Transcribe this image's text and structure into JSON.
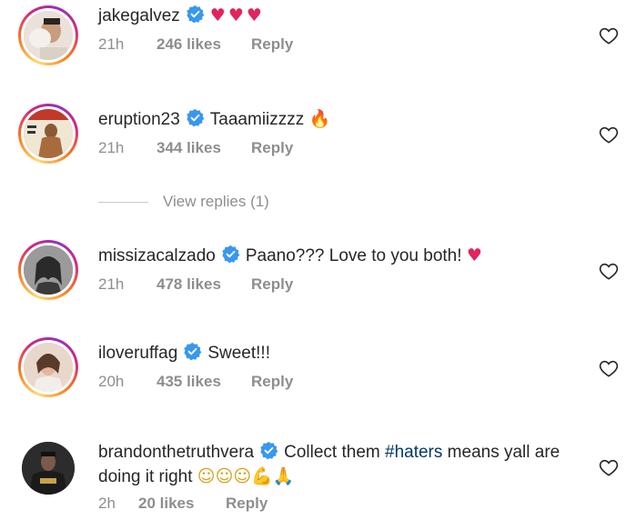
{
  "comments": [
    {
      "username": "jakegalvez",
      "verified": true,
      "text": "",
      "emoji": "♥♥♥",
      "time": "21h",
      "likes": "246 likes",
      "reply": "Reply",
      "avatar_color": "#c9b7a8"
    },
    {
      "username": "eruption23",
      "verified": true,
      "text": "Taaamiizzzz",
      "emoji": "🔥",
      "time": "21h",
      "likes": "344 likes",
      "reply": "Reply",
      "avatar_color": "#b8753f"
    },
    {
      "username": "missizacalzado",
      "verified": true,
      "text": "Paano??? Love to you both!",
      "emoji": "♥",
      "time": "21h",
      "likes": "478 likes",
      "reply": "Reply",
      "avatar_color": "#7a7a7a"
    },
    {
      "username": "iloveruffag",
      "verified": true,
      "text": "Sweet!!!",
      "emoji": "",
      "time": "20h",
      "likes": "435 likes",
      "reply": "Reply",
      "avatar_color": "#d8b7a6"
    },
    {
      "username": "brandonthetruthvera",
      "verified": true,
      "text_before": "Collect them",
      "hashtag": "#haters",
      "text_after": "means yall are doing it right",
      "emoji": "☺☺☺💪🙏",
      "time": "2h",
      "likes": "20 likes",
      "reply": "Reply",
      "avatar_color": "#3a3a3a"
    }
  ],
  "view_replies": "View replies (1)",
  "colors": {
    "primary_text": "#262626",
    "secondary_text": "#8e8e8e",
    "verified_blue": "#3897f0",
    "hashtag": "#00376b",
    "heart_red": "#ed4956"
  }
}
